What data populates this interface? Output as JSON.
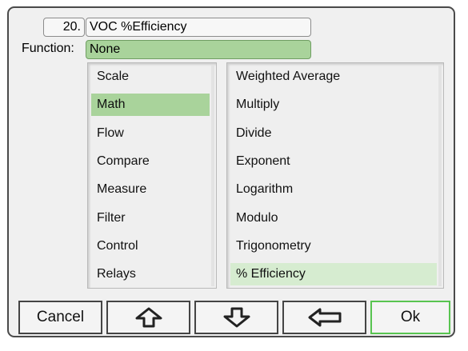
{
  "header": {
    "item_number": "20.",
    "item_name": "VOC %Efficiency"
  },
  "function_selector": {
    "label": "Function:",
    "value": "None"
  },
  "category_list": {
    "items": [
      "Scale",
      "Math",
      "Flow",
      "Compare",
      "Measure",
      "Filter",
      "Control",
      "Relays"
    ],
    "selected": "Math"
  },
  "function_list": {
    "items": [
      "Weighted Average",
      "Multiply",
      "Divide",
      "Exponent",
      "Logarithm",
      "Modulo",
      "Trigonometry",
      "% Efficiency"
    ],
    "selected": "% Efficiency"
  },
  "buttons": {
    "cancel_label": "Cancel",
    "up_icon": "up-arrow-icon",
    "down_icon": "down-arrow-icon",
    "back_icon": "left-arrow-icon",
    "ok_label": "Ok"
  },
  "colors": {
    "selection": "#a9d39b",
    "selection_light": "#d6ecd0",
    "ok_border": "#58c450"
  }
}
